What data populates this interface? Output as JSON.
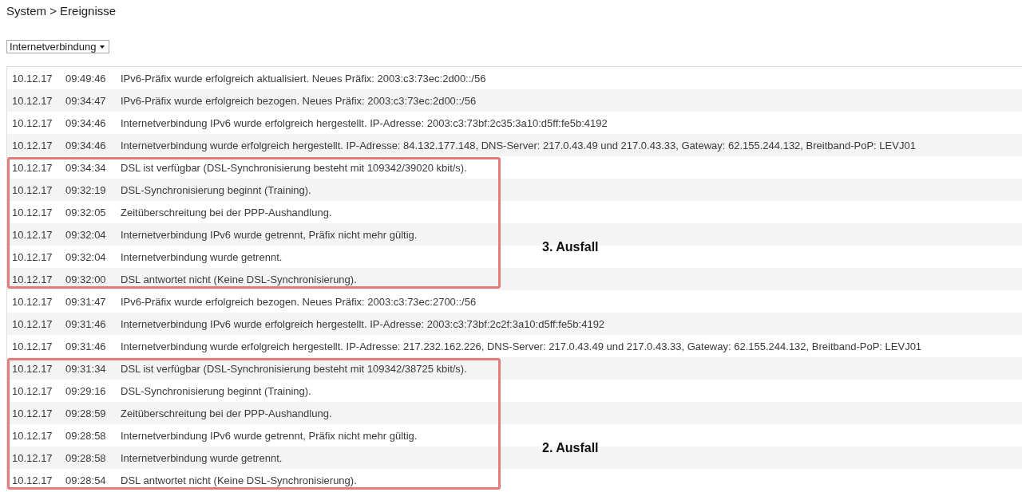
{
  "page": {
    "title": "System > Ereignisse"
  },
  "filter": {
    "value": "Internetverbindung"
  },
  "log": {
    "sections": [
      {
        "kind": "plain",
        "rows": [
          {
            "date": "10.12.17",
            "time": "09:49:46",
            "message": "IPv6-Präfix wurde erfolgreich aktualisiert. Neues Präfix: 2003:c3:73ec:2d00::/56"
          },
          {
            "date": "10.12.17",
            "time": "09:34:47",
            "message": "IPv6-Präfix wurde erfolgreich bezogen. Neues Präfix: 2003:c3:73ec:2d00::/56"
          },
          {
            "date": "10.12.17",
            "time": "09:34:46",
            "message": "Internetverbindung IPv6 wurde erfolgreich hergestellt. IP-Adresse: 2003:c3:73bf:2c35:3a10:d5ff:fe5b:4192"
          },
          {
            "date": "10.12.17",
            "time": "09:34:46",
            "message": "Internetverbindung wurde erfolgreich hergestellt. IP-Adresse: 84.132.177.148, DNS-Server: 217.0.43.49 und 217.0.43.33, Gateway: 62.155.244.132, Breitband-PoP: LEVJ01"
          }
        ]
      },
      {
        "kind": "marked",
        "label": "3. Ausfall",
        "rows": [
          {
            "date": "10.12.17",
            "time": "09:34:34",
            "message": "DSL ist verfügbar (DSL-Synchronisierung besteht mit 109342/39020 kbit/s)."
          },
          {
            "date": "10.12.17",
            "time": "09:32:19",
            "message": "DSL-Synchronisierung beginnt (Training)."
          },
          {
            "date": "10.12.17",
            "time": "09:32:05",
            "message": "Zeitüberschreitung bei der PPP-Aushandlung."
          },
          {
            "date": "10.12.17",
            "time": "09:32:04",
            "message": "Internetverbindung IPv6 wurde getrennt, Präfix nicht mehr gültig."
          },
          {
            "date": "10.12.17",
            "time": "09:32:04",
            "message": "Internetverbindung wurde getrennt."
          },
          {
            "date": "10.12.17",
            "time": "09:32:00",
            "message": "DSL antwortet nicht (Keine DSL-Synchronisierung)."
          }
        ]
      },
      {
        "kind": "plain",
        "rows": [
          {
            "date": "10.12.17",
            "time": "09:31:47",
            "message": "IPv6-Präfix wurde erfolgreich bezogen. Neues Präfix: 2003:c3:73ec:2700::/56"
          },
          {
            "date": "10.12.17",
            "time": "09:31:46",
            "message": "Internetverbindung IPv6 wurde erfolgreich hergestellt. IP-Adresse: 2003:c3:73bf:2c2f:3a10:d5ff:fe5b:4192"
          },
          {
            "date": "10.12.17",
            "time": "09:31:46",
            "message": "Internetverbindung wurde erfolgreich hergestellt. IP-Adresse: 217.232.162.226, DNS-Server: 217.0.43.49 und 217.0.43.33, Gateway: 62.155.244.132, Breitband-PoP: LEVJ01"
          }
        ]
      },
      {
        "kind": "marked",
        "label": "2. Ausfall",
        "rows": [
          {
            "date": "10.12.17",
            "time": "09:31:34",
            "message": "DSL ist verfügbar (DSL-Synchronisierung besteht mit 109342/38725 kbit/s)."
          },
          {
            "date": "10.12.17",
            "time": "09:29:16",
            "message": "DSL-Synchronisierung beginnt (Training)."
          },
          {
            "date": "10.12.17",
            "time": "09:28:59",
            "message": "Zeitüberschreitung bei der PPP-Aushandlung."
          },
          {
            "date": "10.12.17",
            "time": "09:28:58",
            "message": "Internetverbindung IPv6 wurde getrennt, Präfix nicht mehr gültig."
          },
          {
            "date": "10.12.17",
            "time": "09:28:58",
            "message": "Internetverbindung wurde getrennt."
          },
          {
            "date": "10.12.17",
            "time": "09:28:54",
            "message": "DSL antwortet nicht (Keine DSL-Synchronisierung)."
          }
        ]
      }
    ]
  }
}
